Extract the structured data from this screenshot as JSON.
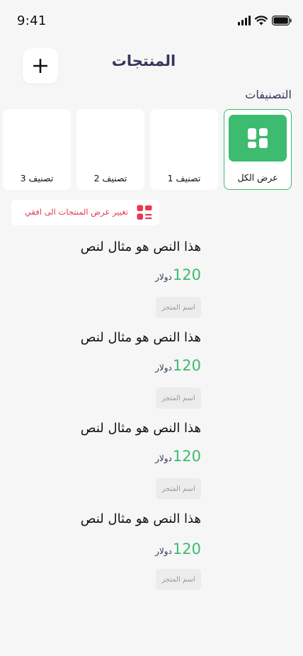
{
  "status_bar": {
    "time": "9:41"
  },
  "header": {
    "title": "المنتجات",
    "add_icon": "plus-icon"
  },
  "categories_section": {
    "title": "التصنيفات",
    "items": [
      {
        "label": "عرض الكل",
        "active": true,
        "icon": "grid-icon"
      },
      {
        "label": "تصنيف 1",
        "active": false
      },
      {
        "label": "تصنيف 2",
        "active": false
      },
      {
        "label": "تصنيف 3",
        "active": false
      }
    ]
  },
  "view_toggle": {
    "label": "تغيير عرض المنتجات الى افقي",
    "icon": "list-layout-icon"
  },
  "products": [
    {
      "title": "هذا النص هو مثال لنص",
      "price": "120",
      "currency": "دولار",
      "store": "اسم المتجر"
    },
    {
      "title": "هذا النص هو مثال لنص",
      "price": "120",
      "currency": "دولار",
      "store": "اسم المتجر"
    },
    {
      "title": "هذا النص هو مثال لنص",
      "price": "120",
      "currency": "دولار",
      "store": "اسم المتجر"
    },
    {
      "title": "هذا النص هو مثال لنص",
      "price": "120",
      "currency": "دولار",
      "store": "اسم المتجر"
    }
  ],
  "colors": {
    "accent": "#3dbb6e",
    "title": "#34375a",
    "danger": "#e63950",
    "background": "#f6f6f6"
  }
}
